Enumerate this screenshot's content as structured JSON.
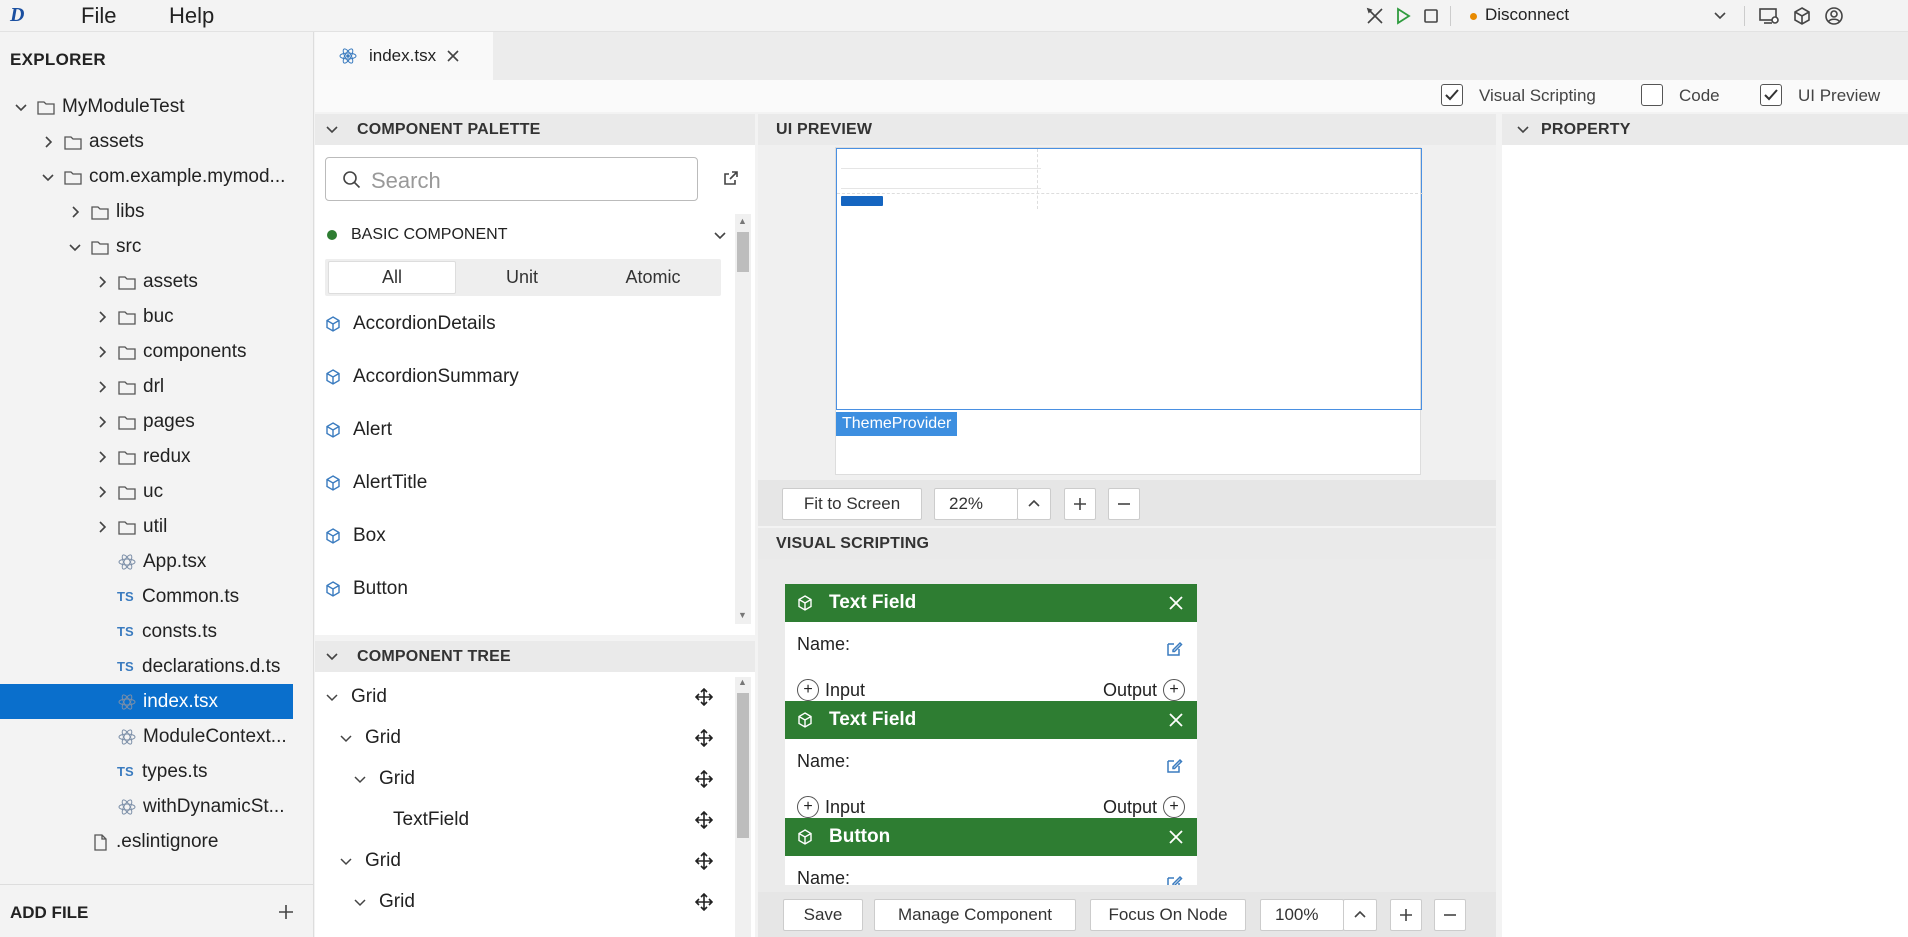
{
  "menubar": {
    "file": "File",
    "help": "Help",
    "connection_status": "Disconnect"
  },
  "explorer": {
    "title": "EXPLORER",
    "add_file": "ADD FILE",
    "items": [
      {
        "label": "MyModuleTest",
        "depth": 0,
        "type": "folder",
        "expanded": true
      },
      {
        "label": "assets",
        "depth": 1,
        "type": "folder",
        "expanded": false
      },
      {
        "label": "com.example.mymod...",
        "depth": 1,
        "type": "folder",
        "expanded": true
      },
      {
        "label": "libs",
        "depth": 2,
        "type": "folder",
        "expanded": false
      },
      {
        "label": "src",
        "depth": 2,
        "type": "folder",
        "expanded": true
      },
      {
        "label": "assets",
        "depth": 3,
        "type": "folder",
        "expanded": false
      },
      {
        "label": "buc",
        "depth": 3,
        "type": "folder",
        "expanded": false
      },
      {
        "label": "components",
        "depth": 3,
        "type": "folder",
        "expanded": false
      },
      {
        "label": "drl",
        "depth": 3,
        "type": "folder",
        "expanded": false
      },
      {
        "label": "pages",
        "depth": 3,
        "type": "folder",
        "expanded": false
      },
      {
        "label": "redux",
        "depth": 3,
        "type": "folder",
        "expanded": false
      },
      {
        "label": "uc",
        "depth": 3,
        "type": "folder",
        "expanded": false
      },
      {
        "label": "util",
        "depth": 3,
        "type": "folder",
        "expanded": false
      },
      {
        "label": "App.tsx",
        "depth": 3,
        "type": "react"
      },
      {
        "label": "Common.ts",
        "depth": 3,
        "type": "ts"
      },
      {
        "label": "consts.ts",
        "depth": 3,
        "type": "ts"
      },
      {
        "label": "declarations.d.ts",
        "depth": 3,
        "type": "ts"
      },
      {
        "label": "index.tsx",
        "depth": 3,
        "type": "react",
        "selected": true
      },
      {
        "label": "ModuleContext...",
        "depth": 3,
        "type": "react"
      },
      {
        "label": "types.ts",
        "depth": 3,
        "type": "ts"
      },
      {
        "label": "withDynamicSt...",
        "depth": 3,
        "type": "react"
      },
      {
        "label": ".eslintignore",
        "depth": 2,
        "type": "file"
      }
    ]
  },
  "tabs": [
    {
      "label": "index.tsx"
    }
  ],
  "toggles": {
    "visual_scripting": {
      "label": "Visual Scripting",
      "checked": true
    },
    "code": {
      "label": "Code",
      "checked": false
    },
    "ui_preview": {
      "label": "UI Preview",
      "checked": true
    }
  },
  "palette": {
    "title": "COMPONENT PALETTE",
    "search_placeholder": "Search",
    "section_title": "BASIC COMPONENT",
    "filters": [
      "All",
      "Unit",
      "Atomic"
    ],
    "active_filter": "All",
    "items": [
      "AccordionDetails",
      "AccordionSummary",
      "Alert",
      "AlertTitle",
      "Box",
      "Button"
    ]
  },
  "component_tree": {
    "title": "COMPONENT TREE",
    "rows": [
      {
        "label": "Grid",
        "depth": 0,
        "expanded": true
      },
      {
        "label": "Grid",
        "depth": 1,
        "expanded": true
      },
      {
        "label": "Grid",
        "depth": 2,
        "expanded": true
      },
      {
        "label": "TextField",
        "depth": 3
      },
      {
        "label": "Grid",
        "depth": 1,
        "expanded": true
      },
      {
        "label": "Grid",
        "depth": 2,
        "expanded": true
      }
    ]
  },
  "ui_preview": {
    "title": "UI PREVIEW",
    "theme_tag": "ThemeProvider",
    "fit_button": "Fit to Screen",
    "zoom": "22%"
  },
  "visual_scripting": {
    "title": "VISUAL SCRIPTING",
    "nodes": [
      {
        "title": "Text Field",
        "name_label": "Name:",
        "input_label": "Input",
        "output_label": "Output"
      },
      {
        "title": "Text Field",
        "name_label": "Name:",
        "input_label": "Input",
        "output_label": "Output"
      },
      {
        "title": "Button",
        "name_label": "Name:"
      }
    ],
    "save_button": "Save",
    "manage_button": "Manage Component",
    "focus_button": "Focus On Node",
    "zoom": "100%"
  },
  "property": {
    "title": "PROPERTY"
  },
  "colors": {
    "accent": "#0a6fcc",
    "node_header": "#2e7d32",
    "status_dot": "#e88a00"
  }
}
